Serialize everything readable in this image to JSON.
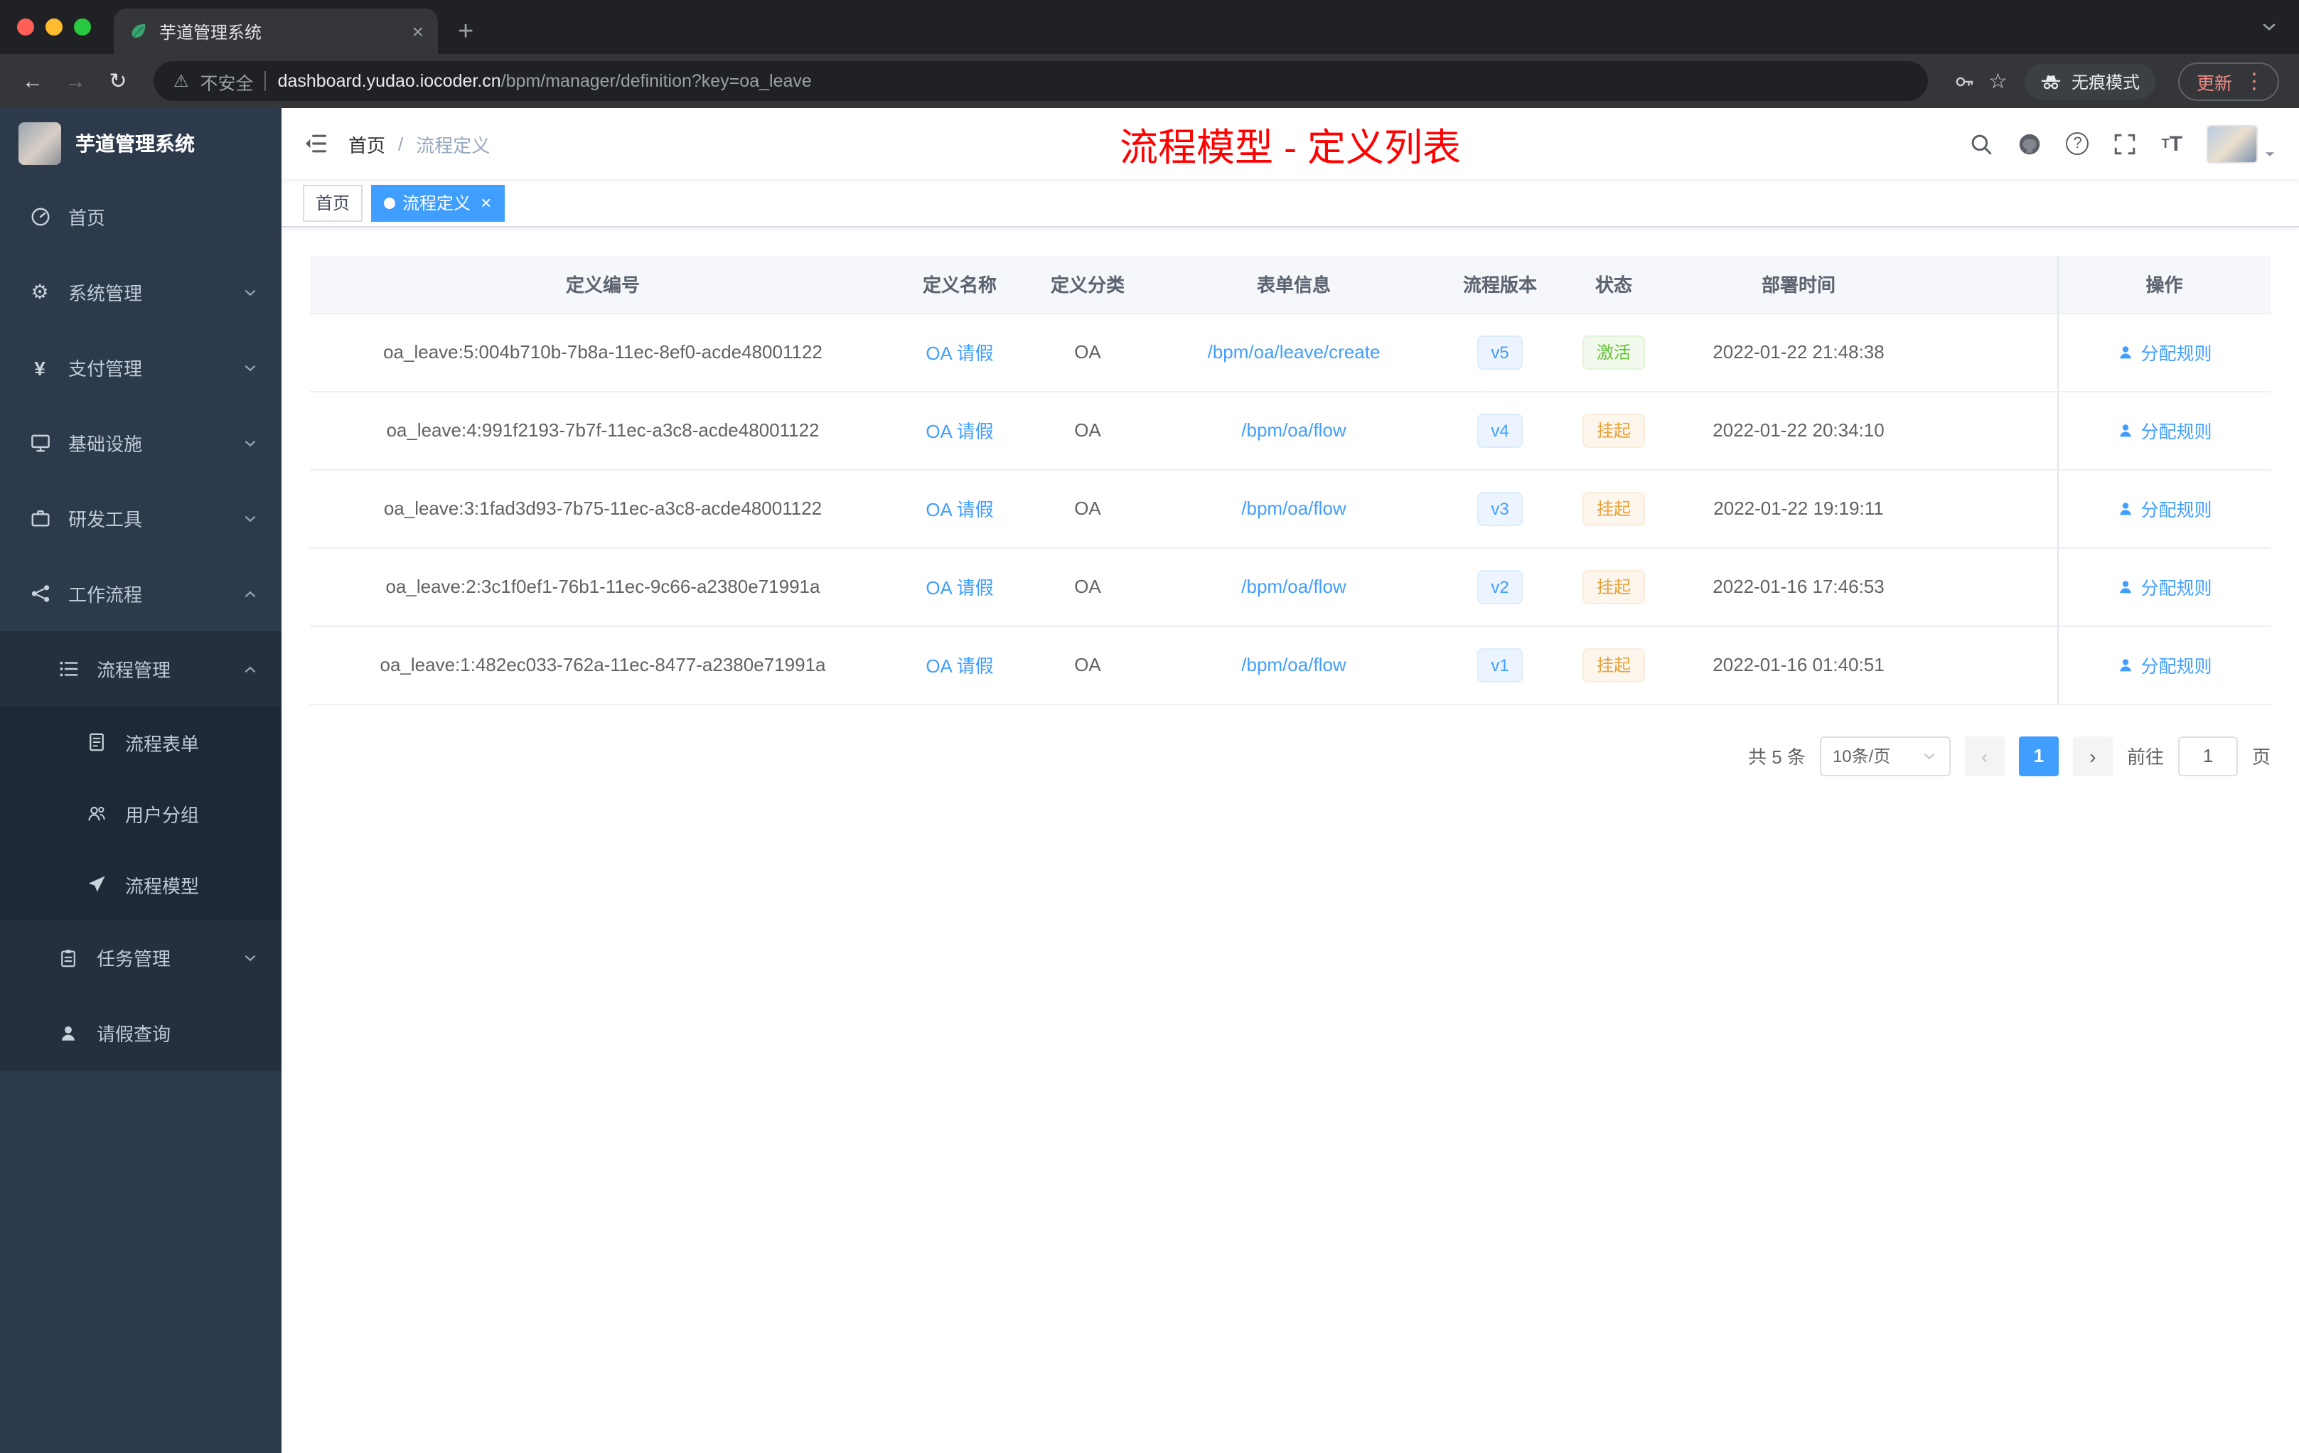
{
  "colors": {
    "accent": "#409EFF",
    "success": "#67C23A",
    "warning": "#E6A23C",
    "title_red": "#FF0000",
    "sidebar_bg": "#2D3A4B"
  },
  "icons": {
    "back": "←",
    "forward": "→",
    "reload": "↻",
    "warning": "⚠",
    "star": "☆",
    "gear": "⚙",
    "yen": "¥",
    "plus": "+",
    "close": "×",
    "dots_vertical": "⋮",
    "question": "?",
    "prev": "‹",
    "next": "›",
    "letter_t": "T"
  },
  "browser": {
    "tab_title": "芋道管理系统",
    "security_label": "不安全",
    "url_domain": "dashboard.yudao.iocoder.cn",
    "url_path": "/bpm/manager/definition?key=oa_leave",
    "incognito_label": "无痕模式",
    "update_label": "更新"
  },
  "sidebar": {
    "app_title": "芋道管理系统",
    "items": [
      {
        "label": "首页"
      },
      {
        "label": "系统管理"
      },
      {
        "label": "支付管理"
      },
      {
        "label": "基础设施"
      },
      {
        "label": "研发工具"
      },
      {
        "label": "工作流程"
      },
      {
        "label": "流程管理"
      },
      {
        "label": "流程表单"
      },
      {
        "label": "用户分组"
      },
      {
        "label": "流程模型"
      },
      {
        "label": "任务管理"
      },
      {
        "label": "请假查询"
      }
    ]
  },
  "header": {
    "breadcrumb_home": "首页",
    "breadcrumb_sep": "/",
    "breadcrumb_current": "流程定义",
    "page_title": "流程模型 - 定义列表"
  },
  "tags": {
    "home": "首页",
    "active": "流程定义"
  },
  "table": {
    "columns": [
      "定义编号",
      "定义名称",
      "定义分类",
      "表单信息",
      "流程版本",
      "状态",
      "部署时间",
      "操作"
    ],
    "action_label": "分配规则",
    "rows": [
      {
        "id": "oa_leave:5:004b710b-7b8a-11ec-8ef0-acde48001122",
        "name": "OA 请假",
        "category": "OA",
        "form": "/bpm/oa/leave/create",
        "version": "v5",
        "status": "激活",
        "deployed": "2022-01-22 21:48:38"
      },
      {
        "id": "oa_leave:4:991f2193-7b7f-11ec-a3c8-acde48001122",
        "name": "OA 请假",
        "category": "OA",
        "form": "/bpm/oa/flow",
        "version": "v4",
        "status": "挂起",
        "deployed": "2022-01-22 20:34:10"
      },
      {
        "id": "oa_leave:3:1fad3d93-7b75-11ec-a3c8-acde48001122",
        "name": "OA 请假",
        "category": "OA",
        "form": "/bpm/oa/flow",
        "version": "v3",
        "status": "挂起",
        "deployed": "2022-01-22 19:19:11"
      },
      {
        "id": "oa_leave:2:3c1f0ef1-76b1-11ec-9c66-a2380e71991a",
        "name": "OA 请假",
        "category": "OA",
        "form": "/bpm/oa/flow",
        "version": "v2",
        "status": "挂起",
        "deployed": "2022-01-16 17:46:53"
      },
      {
        "id": "oa_leave:1:482ec033-762a-11ec-8477-a2380e71991a",
        "name": "OA 请假",
        "category": "OA",
        "form": "/bpm/oa/flow",
        "version": "v1",
        "status": "挂起",
        "deployed": "2022-01-16 01:40:51"
      }
    ]
  },
  "pagination": {
    "total": "共 5 条",
    "page_size": "10条/页",
    "page": "1",
    "goto_label": "前往",
    "goto_value": "1",
    "page_unit": "页"
  }
}
